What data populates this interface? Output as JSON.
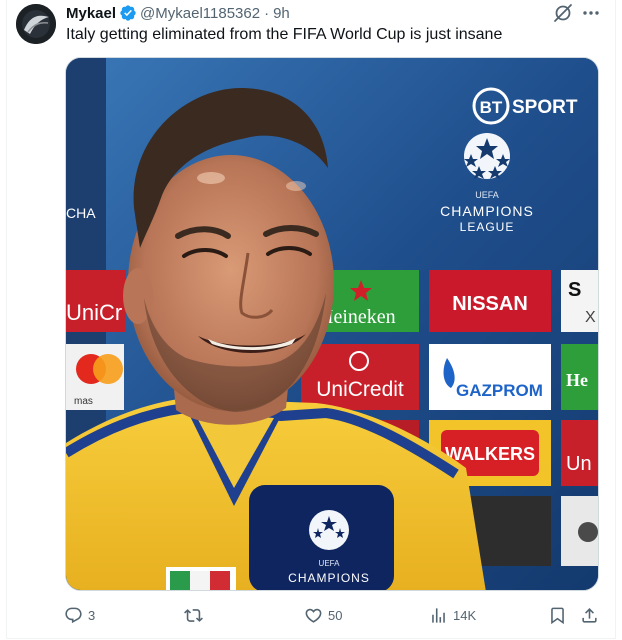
{
  "tweet": {
    "author_name": "Mykael",
    "handle": "@Mykael1185362",
    "separator": "·",
    "time": "9h",
    "text": "Italy getting eliminated from the FIFA World Cup is just insane"
  },
  "media": {
    "broadcaster_bt": "BT",
    "broadcaster_sport": "SPORT",
    "uefa_small": "UEFA",
    "champions": "CHAMPIONS",
    "league": "LEAGUE",
    "left_edge_text": "CHA",
    "sponsors": {
      "unicr_partial": "UniCr",
      "heineken_partial": "Heineken",
      "nissan": "NISSAN",
      "sony_partial": "S",
      "sony_x": "X",
      "mastercard_partial": "mas",
      "unicredit": "UniCredit",
      "gazprom": "GAZPROM",
      "he_partial": "He",
      "walkers": "WALKERS",
      "un_partial": "Un"
    },
    "mic_uefa": "UEFA",
    "mic_champions": "CHAMPIONS"
  },
  "actions": {
    "reply_count": "3",
    "like_count": "50",
    "views_count": "14K"
  },
  "colors": {
    "verified": "#1d9bf0",
    "muted": "#536471",
    "jersey": "#f2c230",
    "jersey_trim": "#1f3f8f"
  }
}
